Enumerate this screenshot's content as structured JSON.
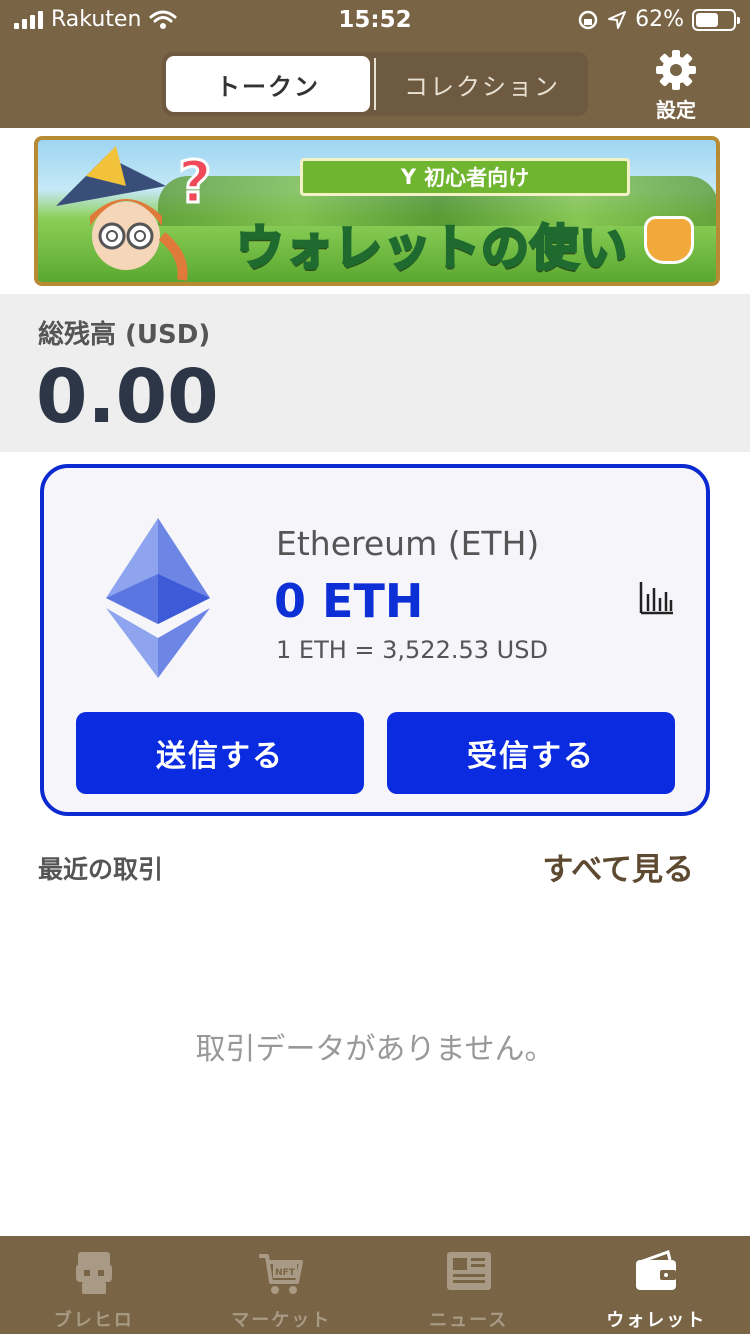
{
  "status_bar": {
    "carrier": "Rakuten",
    "time": "15:52",
    "battery": "62%",
    "battery_level": 0.62
  },
  "header": {
    "tabs": [
      {
        "label": "トークン",
        "active": true
      },
      {
        "label": "コレクション",
        "active": false
      }
    ],
    "settings_label": "設定"
  },
  "banner": {
    "ribbon_text": "初心者向け",
    "title": "ウォレットの使い方",
    "question_mark": "?"
  },
  "balance": {
    "label": "総残高 (USD)",
    "value": "0.00"
  },
  "token_card": {
    "name": "Ethereum (ETH)",
    "amount": "0 ETH",
    "rate": "1 ETH = 3,522.53 USD",
    "send_label": "送信する",
    "receive_label": "受信する"
  },
  "recent": {
    "title": "最近の取引",
    "see_all": "すべて見る",
    "empty_text": "取引データがありません。"
  },
  "tabbar": {
    "items": [
      {
        "label": "ブレヒロ",
        "icon": "hero-icon",
        "active": false
      },
      {
        "label": "マーケット",
        "icon": "cart-nft-icon",
        "active": false
      },
      {
        "label": "ニュース",
        "icon": "newspaper-icon",
        "active": false
      },
      {
        "label": "ウォレット",
        "icon": "wallet-icon",
        "active": true
      }
    ]
  },
  "colors": {
    "brand_brown": "#7a6446",
    "accent_blue": "#0a2be0"
  }
}
